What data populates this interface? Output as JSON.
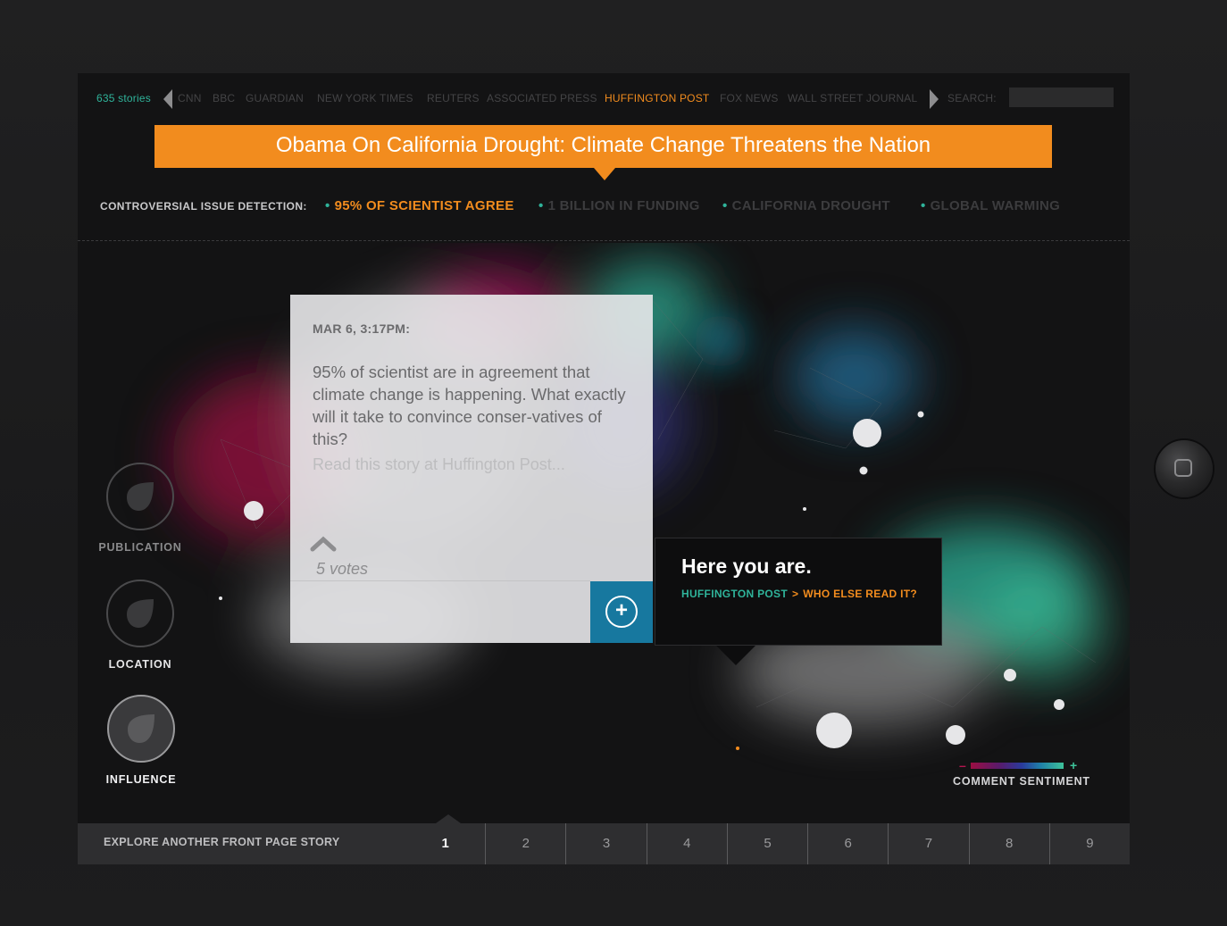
{
  "nav": {
    "story_count": "635 stories",
    "sources": [
      {
        "label": "CNN",
        "active": false
      },
      {
        "label": "BBC",
        "active": false
      },
      {
        "label": "GUARDIAN",
        "active": false
      },
      {
        "label": "NEW YORK TIMES",
        "active": false
      },
      {
        "label": "REUTERS",
        "active": false
      },
      {
        "label": "ASSOCIATED PRESS",
        "active": false
      },
      {
        "label": "HUFFINGTON POST",
        "active": true
      },
      {
        "label": "FOX NEWS",
        "active": false
      },
      {
        "label": "WALL STREET JOURNAL",
        "active": false
      }
    ],
    "search_label": "SEARCH:",
    "search_value": ""
  },
  "headline": "Obama On California Drought: Climate Change Threatens the Nation",
  "issues": {
    "label": "CONTROVERSIAL ISSUE DETECTION:",
    "items": [
      {
        "label": "95% OF SCIENTIST AGREE",
        "active": true
      },
      {
        "label": "1 BILLION IN FUNDING",
        "active": false
      },
      {
        "label": "CALIFORNIA  DROUGHT",
        "active": false
      },
      {
        "label": "GLOBAL WARMING",
        "active": false
      }
    ]
  },
  "comment": {
    "date": "MAR 6, 3:17PM:",
    "body": "95% of scientist are in agreement that climate change is happening. What exactly will it take to convince conser-vatives of this?",
    "link": "Read this story at Huffington Post...",
    "votes": "5 votes",
    "add_symbol": "+"
  },
  "here": {
    "title": "Here you are.",
    "crumb_source": "HUFFINGTON POST",
    "crumb_sep": ">",
    "crumb_action": "WHO ELSE READ IT?"
  },
  "filters": [
    {
      "label": "PUBLICATION",
      "active": false
    },
    {
      "label": "LOCATION",
      "active": false
    },
    {
      "label": "INFLUENCE",
      "active": true
    }
  ],
  "sentiment": {
    "minus": "–",
    "plus": "+",
    "label": "COMMENT SENTIMENT",
    "colors": [
      "#9b0e42",
      "#5a1a6a",
      "#2a3a9b",
      "#1f7fa8",
      "#3ec39a"
    ]
  },
  "bottom": {
    "label": "EXPLORE ANOTHER FRONT PAGE STORY",
    "pages": [
      "1",
      "2",
      "3",
      "4",
      "5",
      "6",
      "7",
      "8",
      "9"
    ],
    "active_page": "1"
  },
  "colors": {
    "accent": "#f28c1e",
    "teal": "#2fb39a",
    "blue": "#17789f"
  }
}
